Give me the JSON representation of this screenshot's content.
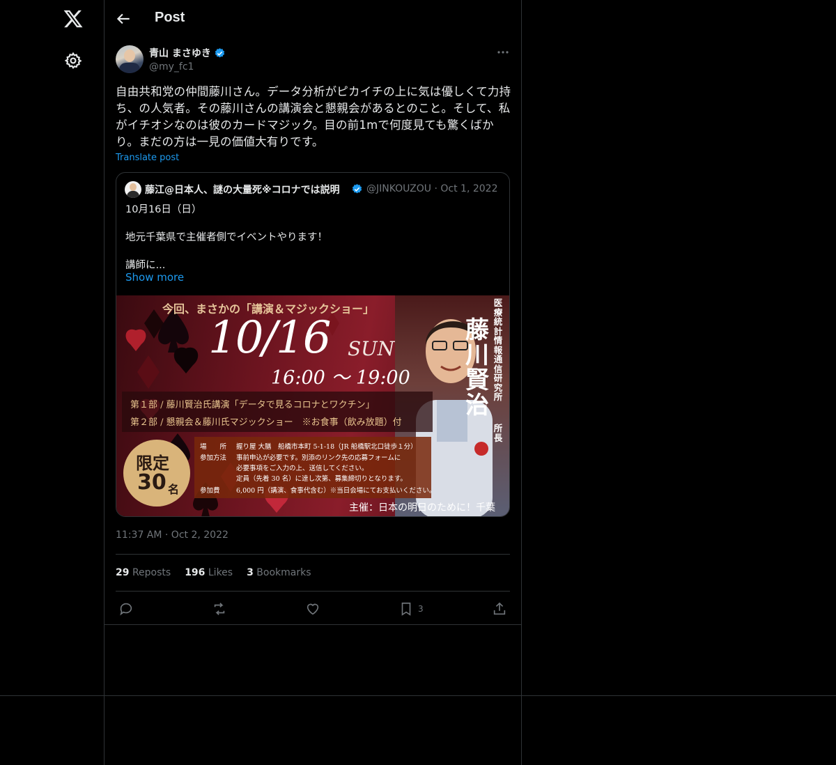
{
  "nav": {
    "logo_icon": "x-logo-icon",
    "settings_icon": "gear-icon"
  },
  "header": {
    "title": "Post",
    "back_icon": "arrow-left-icon"
  },
  "post": {
    "author_name": "青山 まさゆき",
    "author_handle": "@my_fc1",
    "verified": true,
    "text": "自由共和党の仲間藤川さん。データ分析がピカイチの上に気は優しくて力持ち、の人気者。その藤川さんの講演会と懇親会があるとのこと。そして、私がイチオシなのは彼のカードマジック。目の前1mで何度見ても驚くばかり。まだの方は一見の価値大有りです。",
    "translate_label": "Translate post",
    "timestamp": "11:37 AM · Oct 2, 2022"
  },
  "quote": {
    "author_name": "藤江@日本人、謎の大量死※コロナでは説明",
    "author_handle": "@JINKOUZOU",
    "date": "Oct 1, 2022",
    "line1": "10月16日（日）",
    "line2": "地元千葉県で主催者側でイベントやります！",
    "line3": "講師に...",
    "show_more": "Show more",
    "flyer": {
      "top": "今回、まさかの「講演＆マジックショー」",
      "date": "10/16",
      "day": "SUN",
      "time": "16:00 〜 19:00",
      "part1": "第１部 / 藤川賢治氏講演「データで見るコロナとワクチン」",
      "part2": "第２部 / 懇親会＆藤川氏マジックショー　※お食事（飲み放題）付",
      "venue_label": "場　　所",
      "venue": "握り屋 大膳　船橋市本町 5-1-18（JR 船橋駅北口徒歩１分）",
      "method_label": "参加方法",
      "method1": "事前申込が必要です。別添のリンク先の応募フォームに",
      "method2": "必要事項をご入力の上、送信してください。",
      "method3": "定員（先着 30 名）に達し次第、募集締切りとなります。",
      "fee_label": "参加費",
      "fee": "6,000 円（講演、食事代含む）※当日会場にてお支払いください。",
      "limit1": "限定",
      "limit2": "30",
      "limit3": "名",
      "organizer": "主催：日本の明日のために！千葉",
      "speaker": "藤川賢治",
      "speaker_org": "医療統計情報通信研究所",
      "speaker_title": "所長"
    }
  },
  "stats": {
    "reposts_count": "29",
    "reposts_label": "Reposts",
    "likes_count": "196",
    "likes_label": "Likes",
    "bookmarks_count": "3",
    "bookmarks_label": "Bookmarks"
  },
  "actions": {
    "reply_icon": "reply-icon",
    "repost_icon": "repost-icon",
    "like_icon": "heart-icon",
    "bookmark_icon": "bookmark-icon",
    "bookmark_count": "3",
    "share_icon": "share-icon"
  },
  "colors": {
    "accent": "#1d9bf0",
    "background": "#000000",
    "muted": "#71767b",
    "border": "#2f3336"
  }
}
